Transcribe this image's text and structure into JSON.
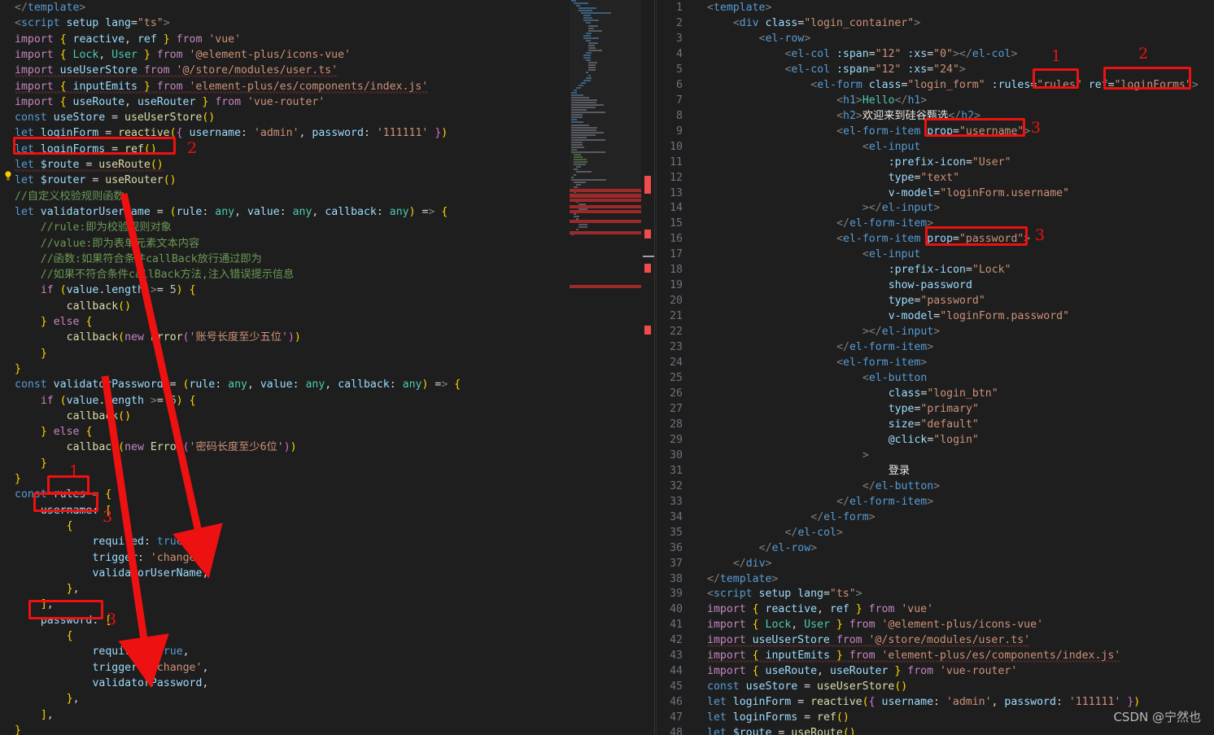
{
  "app": {
    "theme_background": "#1e1e1e",
    "annotation_color": "#ee1111",
    "watermark": "CSDN @宁然也"
  },
  "left_editor": {
    "name": "left-code-pane",
    "start_visual_line": 1,
    "lines": [
      "</template>",
      "<script setup lang=\"ts\">",
      "import { reactive, ref } from 'vue'",
      "import { Lock, User } from '@element-plus/icons-vue'",
      "import useUserStore from '@/store/modules/user.ts'",
      "import { inputEmits } from 'element-plus/es/components/index.js'",
      "import { useRoute, useRouter } from 'vue-router'",
      "const useStore = useUserStore()",
      "let loginForm = reactive({ username: 'admin', password: '111111' })",
      "let loginForms = ref()",
      "let $route = useRoute()",
      "let $router = useRouter()",
      "//自定义校验规则函数",
      "let validatorUserName = (rule: any, value: any, callback: any) => {",
      "    //rule:即为校验规则对象",
      "    //value:即为表单元素文本内容",
      "    //函数:如果符合条件callBack放行通过即为",
      "    //如果不符合条件callBack方法,注入错误提示信息",
      "    if (value.length >= 5) {",
      "        callback()",
      "    } else {",
      "        callback(new Error('账号长度至少五位'))",
      "    }",
      "}",
      "const validatorPassword = (rule: any, value: any, callback: any) => {",
      "    if (value.length >= 6) {",
      "        callback()",
      "    } else {",
      "        callback(new Error('密码长度至少6位'))",
      "    }",
      "}",
      "const rules = {",
      "    username: [",
      "        {",
      "            required: true,",
      "            trigger: 'change',",
      "            validatorUserName,",
      "        },",
      "    ],",
      "    password: [",
      "        {",
      "            required: true,",
      "            trigger: 'change',",
      "            validatorPassword,",
      "        },",
      "    ],",
      "}"
    ]
  },
  "right_editor": {
    "name": "right-code-pane",
    "first_line_number": 1,
    "last_line_number": 48,
    "lines": [
      {
        "n": "1",
        "text": "<template>"
      },
      {
        "n": "2",
        "text": "    <div class=\"login_container\">"
      },
      {
        "n": "3",
        "text": "        <el-row>"
      },
      {
        "n": "4",
        "text": "            <el-col :span=\"12\" :xs=\"0\"></el-col>"
      },
      {
        "n": "5",
        "text": "            <el-col :span=\"12\" :xs=\"24\">"
      },
      {
        "n": "6",
        "text": "                <el-form class=\"login_form\" :rules=\"rules\" ref=\"loginForms\">"
      },
      {
        "n": "7",
        "text": "                    <h1>Hello</h1>"
      },
      {
        "n": "8",
        "text": "                    <h2>欢迎来到硅谷甄选</h2>"
      },
      {
        "n": "9",
        "text": "                    <el-form-item prop=\"username\">"
      },
      {
        "n": "10",
        "text": "                        <el-input"
      },
      {
        "n": "11",
        "text": "                            :prefix-icon=\"User\""
      },
      {
        "n": "12",
        "text": "                            type=\"text\""
      },
      {
        "n": "13",
        "text": "                            v-model=\"loginForm.username\""
      },
      {
        "n": "14",
        "text": "                        ></el-input>"
      },
      {
        "n": "15",
        "text": "                    </el-form-item>"
      },
      {
        "n": "16",
        "text": "                    <el-form-item prop=\"password\">"
      },
      {
        "n": "17",
        "text": "                        <el-input"
      },
      {
        "n": "18",
        "text": "                            :prefix-icon=\"Lock\""
      },
      {
        "n": "19",
        "text": "                            show-password"
      },
      {
        "n": "20",
        "text": "                            type=\"password\""
      },
      {
        "n": "21",
        "text": "                            v-model=\"loginForm.password\""
      },
      {
        "n": "22",
        "text": "                        ></el-input>"
      },
      {
        "n": "23",
        "text": "                    </el-form-item>"
      },
      {
        "n": "24",
        "text": "                    <el-form-item>"
      },
      {
        "n": "25",
        "text": "                        <el-button"
      },
      {
        "n": "26",
        "text": "                            class=\"login_btn\""
      },
      {
        "n": "27",
        "text": "                            type=\"primary\""
      },
      {
        "n": "28",
        "text": "                            size=\"default\""
      },
      {
        "n": "29",
        "text": "                            @click=\"login\""
      },
      {
        "n": "30",
        "text": "                        >"
      },
      {
        "n": "31",
        "text": "                            登录"
      },
      {
        "n": "32",
        "text": "                        </el-button>"
      },
      {
        "n": "33",
        "text": "                    </el-form-item>"
      },
      {
        "n": "34",
        "text": "                </el-form>"
      },
      {
        "n": "35",
        "text": "            </el-col>"
      },
      {
        "n": "36",
        "text": "        </el-row>"
      },
      {
        "n": "37",
        "text": "    </div>"
      },
      {
        "n": "38",
        "text": "</template>"
      },
      {
        "n": "39",
        "text": "<script setup lang=\"ts\">"
      },
      {
        "n": "40",
        "text": "import { reactive, ref } from 'vue'"
      },
      {
        "n": "41",
        "text": "import { Lock, User } from '@element-plus/icons-vue'"
      },
      {
        "n": "42",
        "text": "import useUserStore from '@/store/modules/user.ts'"
      },
      {
        "n": "43",
        "text": "import { inputEmits } from 'element-plus/es/components/index.js'"
      },
      {
        "n": "44",
        "text": "import { useRoute, useRouter } from 'vue-router'"
      },
      {
        "n": "45",
        "text": "const useStore = useUserStore()"
      },
      {
        "n": "46",
        "text": "let loginForm = reactive({ username: 'admin', password: '111111' })"
      },
      {
        "n": "47",
        "text": "let loginForms = ref()"
      },
      {
        "n": "48",
        "text": "let $route = useRoute()"
      }
    ]
  },
  "annotations": {
    "labels": [
      {
        "id": "a1",
        "text": "1",
        "target": "rules-definition-left"
      },
      {
        "id": "a2",
        "text": "2",
        "target": "loginForms-ref-left"
      },
      {
        "id": "a3",
        "text": "3",
        "target": "username-rule-key-left"
      },
      {
        "id": "a4",
        "text": "3",
        "target": "password-rule-key-left"
      },
      {
        "id": "a5",
        "text": "1",
        "target": "rules-binding-right"
      },
      {
        "id": "a6",
        "text": "2",
        "target": "loginForms-ref-right"
      },
      {
        "id": "a7",
        "text": "3",
        "target": "prop-username-right"
      },
      {
        "id": "a8",
        "text": "3",
        "target": "prop-password-right"
      }
    ],
    "highlighted_snippets": [
      "let loginForms = ref()",
      "rules",
      "username:",
      "password:",
      "\"rules\"",
      "\"loginForms\"",
      "prop=\"username\"",
      "prop=\"password\""
    ]
  }
}
